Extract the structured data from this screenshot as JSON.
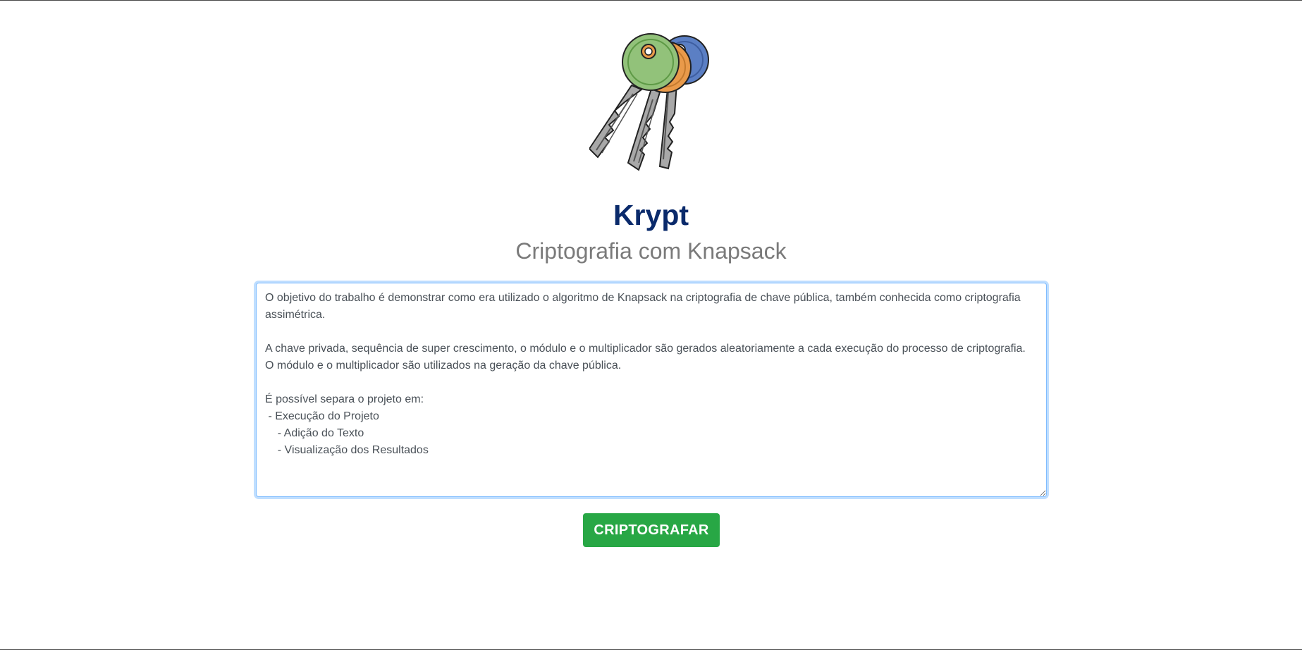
{
  "app": {
    "title": "Krypt",
    "subtitle": "Criptografia com Knapsack",
    "logo_icon": "keys-icon"
  },
  "editor": {
    "value": "O objetivo do trabalho é demonstrar como era utilizado o algoritmo de Knapsack na criptografia de chave pública, também conhecida como criptografia assimétrica.\n\nA chave privada, sequência de super crescimento, o módulo e o multiplicador são gerados aleatoriamente a cada execução do processo de criptografia.\nO módulo e o multiplicador são utilizados na geração da chave pública.\n\nÉ possível separa o projeto em:\n - Execução do Projeto\n    - Adição do Texto\n    - Visualização dos Resultados"
  },
  "actions": {
    "encrypt_label": "CRIPTOGRAFAR"
  },
  "colors": {
    "title": "#0a2a6b",
    "subtitle": "#7a7a7a",
    "button": "#28a745",
    "focus_border": "#80bdff"
  }
}
